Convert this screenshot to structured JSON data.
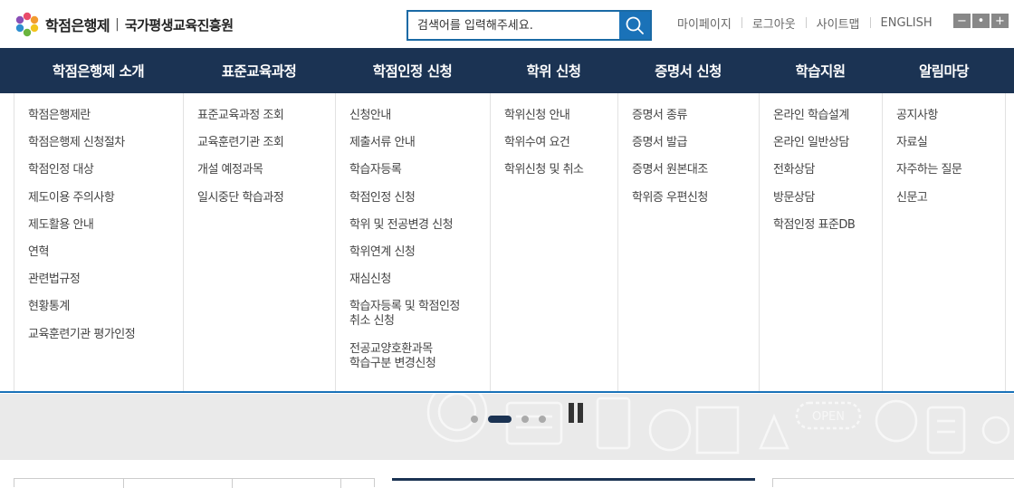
{
  "header": {
    "logo_title": "학점은행제",
    "logo_separator": "|",
    "logo_subtitle": "국가평생교육진흥원",
    "search_placeholder": "검색어를 입력해주세요.",
    "util_links": [
      "마이페이지",
      "로그아웃",
      "사이트맵",
      "ENGLISH"
    ],
    "font_controls": [
      "−",
      "•",
      "+"
    ]
  },
  "gnb": {
    "items": [
      "학점은행제 소개",
      "표준교육과정",
      "학점인정 신청",
      "학위 신청",
      "증명서 신청",
      "학습지원",
      "알림마당"
    ]
  },
  "mega_menu": {
    "columns": [
      [
        "학점은행제란",
        "학점은행제 신청절차",
        "학점인정 대상",
        "제도이용 주의사항",
        "제도활용 안내",
        "연혁",
        "관련법규정",
        "현황통계",
        "교육훈련기관 평가인정"
      ],
      [
        "표준교육과정 조회",
        "교육훈련기관 조회",
        "개설 예정과목",
        "일시중단 학습과정"
      ],
      [
        "신청안내",
        "제출서류 안내",
        "학습자등록",
        "학점인정 신청",
        "학위 및 전공변경 신청",
        "학위연계 신청",
        "재심신청",
        "학습자등록 및 학점인정\n취소 신청",
        "전공교양호환과목\n학습구분 변경신청"
      ],
      [
        "학위신청 안내",
        "학위수여 요건",
        "학위신청 및 취소"
      ],
      [
        "증명서 종류",
        "증명서 발급",
        "증명서 원본대조",
        "학위증 우편신청"
      ],
      [
        "온라인 학습설계",
        "온라인 일반상담",
        "전화상담",
        "방문상담",
        "학점인정 표준DB"
      ],
      [
        "공지사항",
        "자료실",
        "자주하는 질문",
        "신문고"
      ]
    ]
  },
  "slider": {
    "slide_count": 4,
    "active_index": 1,
    "background_label": "OPEN"
  },
  "colors": {
    "navy": "#1b3353",
    "accent_blue": "#1a72b8",
    "visual_bg": "#eaeaea"
  },
  "icons": [
    "logo-flower-icon",
    "search-icon",
    "pause-icon"
  ]
}
